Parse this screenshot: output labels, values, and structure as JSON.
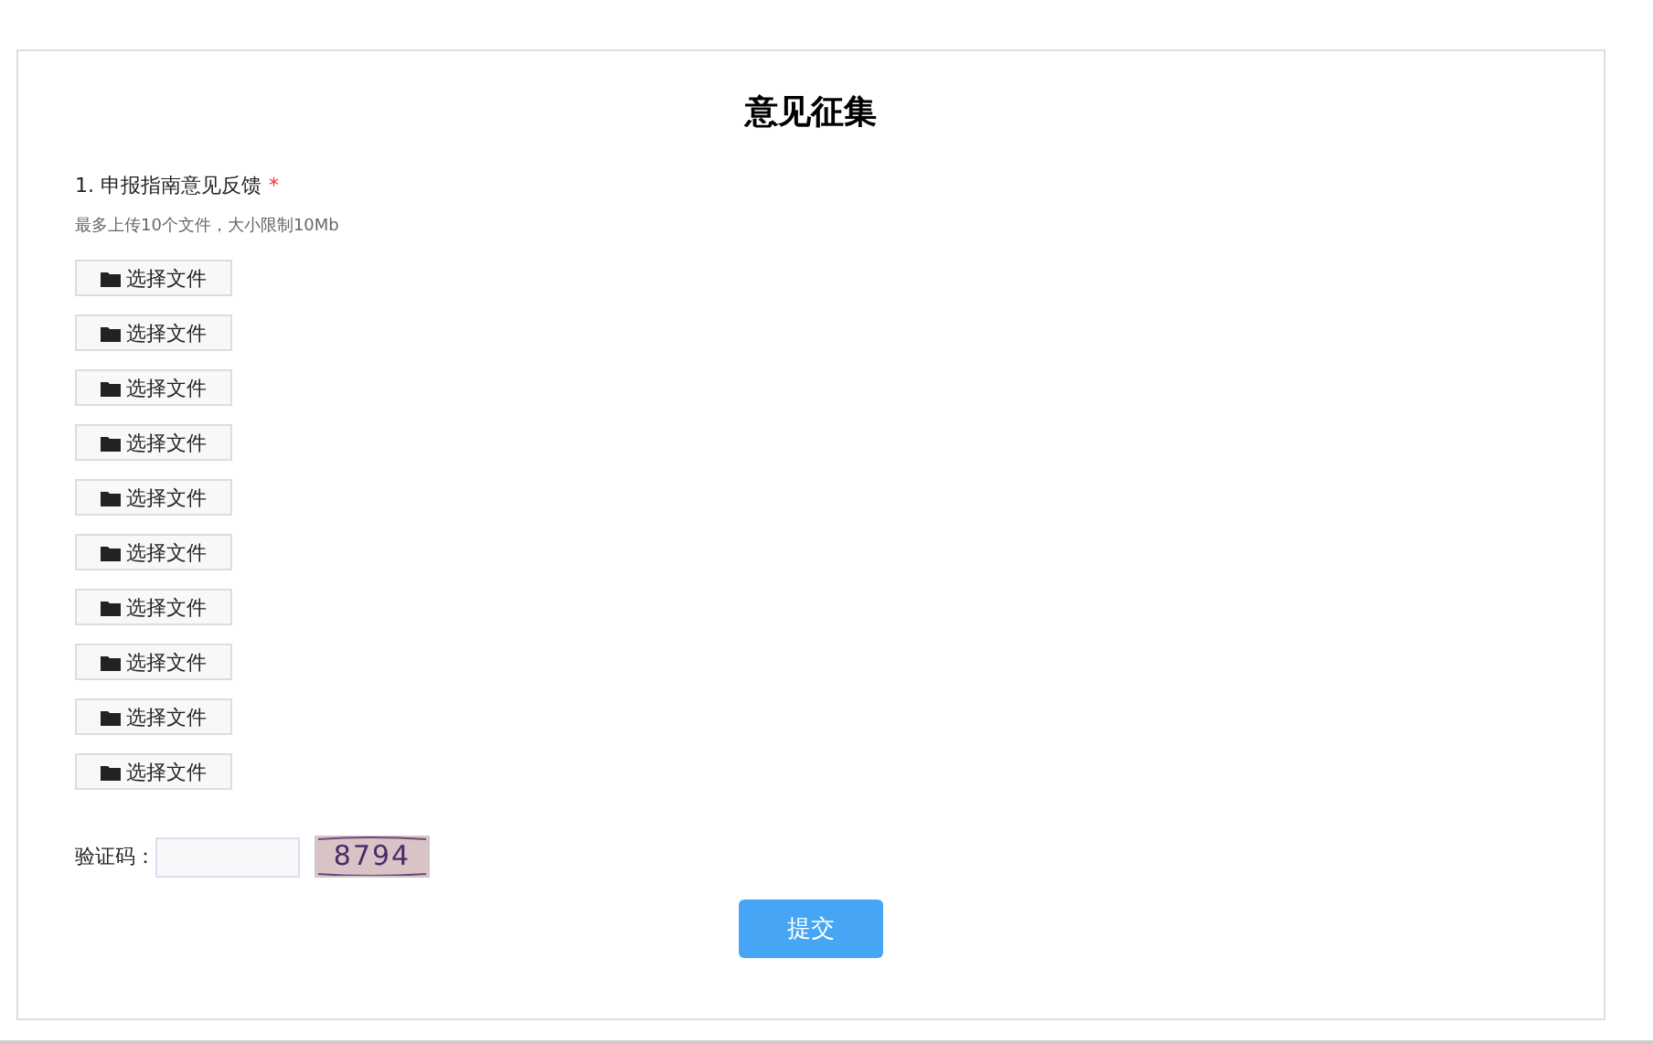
{
  "title": "意见征集",
  "question": {
    "label": "1. 申报指南意见反馈",
    "required_mark": "*",
    "hint": "最多上传10个文件，大小限制10Mb"
  },
  "file_buttons": [
    "选择文件",
    "选择文件",
    "选择文件",
    "选择文件",
    "选择文件",
    "选择文件",
    "选择文件",
    "选择文件",
    "选择文件",
    "选择文件"
  ],
  "captcha": {
    "label": "验证码：",
    "code": "8794"
  },
  "submit": "提交"
}
